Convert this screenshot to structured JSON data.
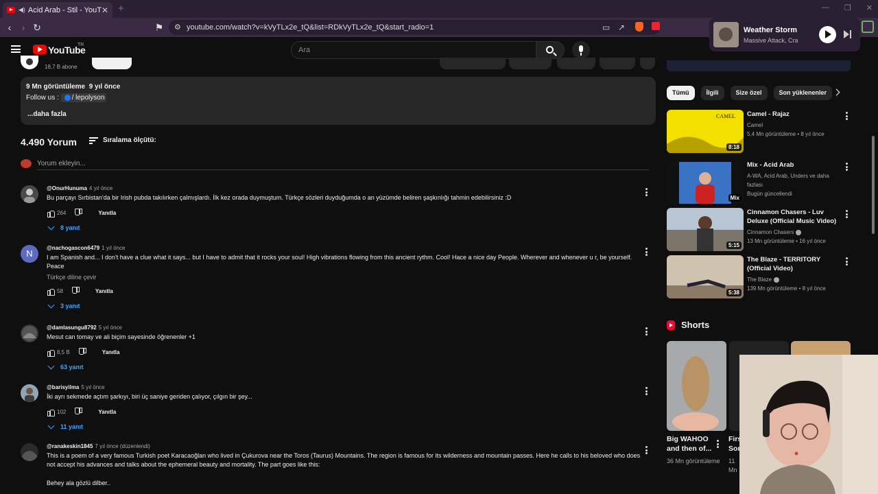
{
  "browser": {
    "tab_title": "Acid Arab - Stil - YouTube",
    "url": "youtube.com/watch?v=kVyTLx2e_tQ&list=RDkVyTLx2e_tQ&start_radio=1",
    "new_tab": "+",
    "close": "✕"
  },
  "youtube": {
    "logo_text": "YouTube",
    "region": "TR",
    "search_placeholder": "Ara"
  },
  "channel": {
    "subscribers": "18,7 B abone"
  },
  "description": {
    "views": "9 Mn görüntüleme",
    "age": "9 yıl önce",
    "follow_prefix": "Follow us :",
    "follow_link": "/ lepolyson",
    "more": "...daha fazla"
  },
  "comments_header": {
    "count": "4.490 Yorum",
    "sort_label": "Sıralama ölçütü:",
    "add_placeholder": "Yorum ekleyin..."
  },
  "comments": [
    {
      "author": "@OnurHunuma",
      "time": "4 yıl önce",
      "text": "Bu parçayı Sırbistan'da bir Irish pubda takılırken çalmışlardı. İlk kez orada duymuştum. Türkçe sözleri duyduğumda o an yüzümde beliren şaşkınlığı tahmin edebilirsiniz :D",
      "likes": "264",
      "reply_label": "Yanıtla",
      "replies": "8 yanıt"
    },
    {
      "author": "@nachogascon6479",
      "time": "1 yıl önce",
      "avatar_letter": "N",
      "text": "I am Spanish and... I don't have a clue what it says... but I have to admit that it rocks your soul! High vibrations flowing from this ancient rythm. Cool! Hace a nice day People. Wherever and whenever u r, be yourself. Peace",
      "translate": "Türkçe diline çevir",
      "likes": "58",
      "reply_label": "Yanıtla",
      "replies": "3 yanıt"
    },
    {
      "author": "@damlasungu8792",
      "time": "5 yıl önce",
      "text": "Mesut can tomay ve ali biçim sayesinde öğrenenler +1",
      "likes": "8,5 B",
      "reply_label": "Yanıtla",
      "replies": "63 yanıt"
    },
    {
      "author": "@barisyilma",
      "time": "5 yıl önce",
      "text": "İki ayrı sekmede açtım şarkıyı, biri üç saniye geriden çalıyor, çılgın bir şey...",
      "likes": "102",
      "reply_label": "Yanıtla",
      "replies": "11 yanıt"
    },
    {
      "author": "@ranakeskin1845",
      "time": "7 yıl önce (düzenlendi)",
      "text": "This is a poem of a very famous Turkish poet Karacaoğlan who lived in Çukurova near the Toros (Taurus) Mountains. The region is famous for its wilderness and mountain passes. Here he calls to his beloved who does not accept his advances and talks about the ephemeral beauty and mortality. The part goes like this:",
      "text2": "Behey ala gözlü dilber.."
    }
  ],
  "chips": [
    "Tümü",
    "İlgili",
    "Size özel",
    "Son yüklenenler"
  ],
  "recommendations": [
    {
      "title": "Camel - Rajaz",
      "channel": "Camel",
      "meta": "5,4 Mn görüntüleme • 8 yıl önce",
      "duration": "8:18",
      "thumb_color": "#e8d400"
    },
    {
      "title": "Mix - Acid Arab",
      "channel": "A-WA, Acid Arab, Unders ve daha fazlası",
      "meta": "Bugün güncellendi",
      "duration": "Mix",
      "thumb_color": "#2c5ea8"
    },
    {
      "title": "Cinnamon Chasers - Luv Deluxe (Official Music Video)",
      "channel": "Cinnamon Chasers",
      "meta": "13 Mn görüntüleme • 16 yıl önce",
      "duration": "5:15",
      "thumb_color": "#9aa6b3"
    },
    {
      "title": "The Blaze - TERRITORY (Official Video)",
      "channel": "The Blaze",
      "meta": "139 Mn görüntüleme • 8 yıl önce",
      "duration": "5:38",
      "thumb_color": "#a08f7c"
    }
  ],
  "shorts": {
    "heading": "Shorts",
    "items": [
      {
        "title": "Big WAHOO and then of...",
        "views": "36 Mn görüntüleme"
      },
      {
        "title": "Firs Sor",
        "views": "11 Mn"
      }
    ]
  },
  "mini_player": {
    "title": "Weather Storm",
    "artist": "Massive Attack, Craig"
  },
  "colors": {
    "accent_blue": "#3ea6ff",
    "youtube_red": "#ff0000",
    "background": "#0f0f0f",
    "browser_chrome": "#3a2a44"
  }
}
